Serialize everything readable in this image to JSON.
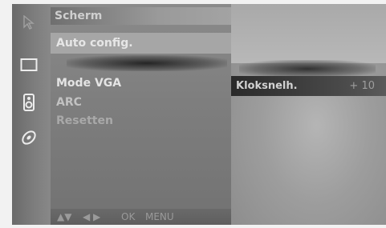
{
  "menu": {
    "title": "Scherm",
    "items": [
      {
        "label": "Auto config."
      },
      {
        "label": "Mode VGA"
      },
      {
        "label": "ARC"
      },
      {
        "label": "Resetten"
      }
    ],
    "nav_hint": {
      "arrows_ud": "▲▼",
      "arrows_lr": "◀ ▶",
      "ok": "OK",
      "menu": "MENU"
    }
  },
  "submenu": {
    "label": "Kloksnelh.",
    "value": "+ 10"
  },
  "icons": [
    "cursor-icon",
    "screen-icon",
    "speaker-icon",
    "disc-icon"
  ],
  "colors": {
    "selected_bg": "#a6a6a6",
    "active_row_bg": "#2a2a2a"
  }
}
